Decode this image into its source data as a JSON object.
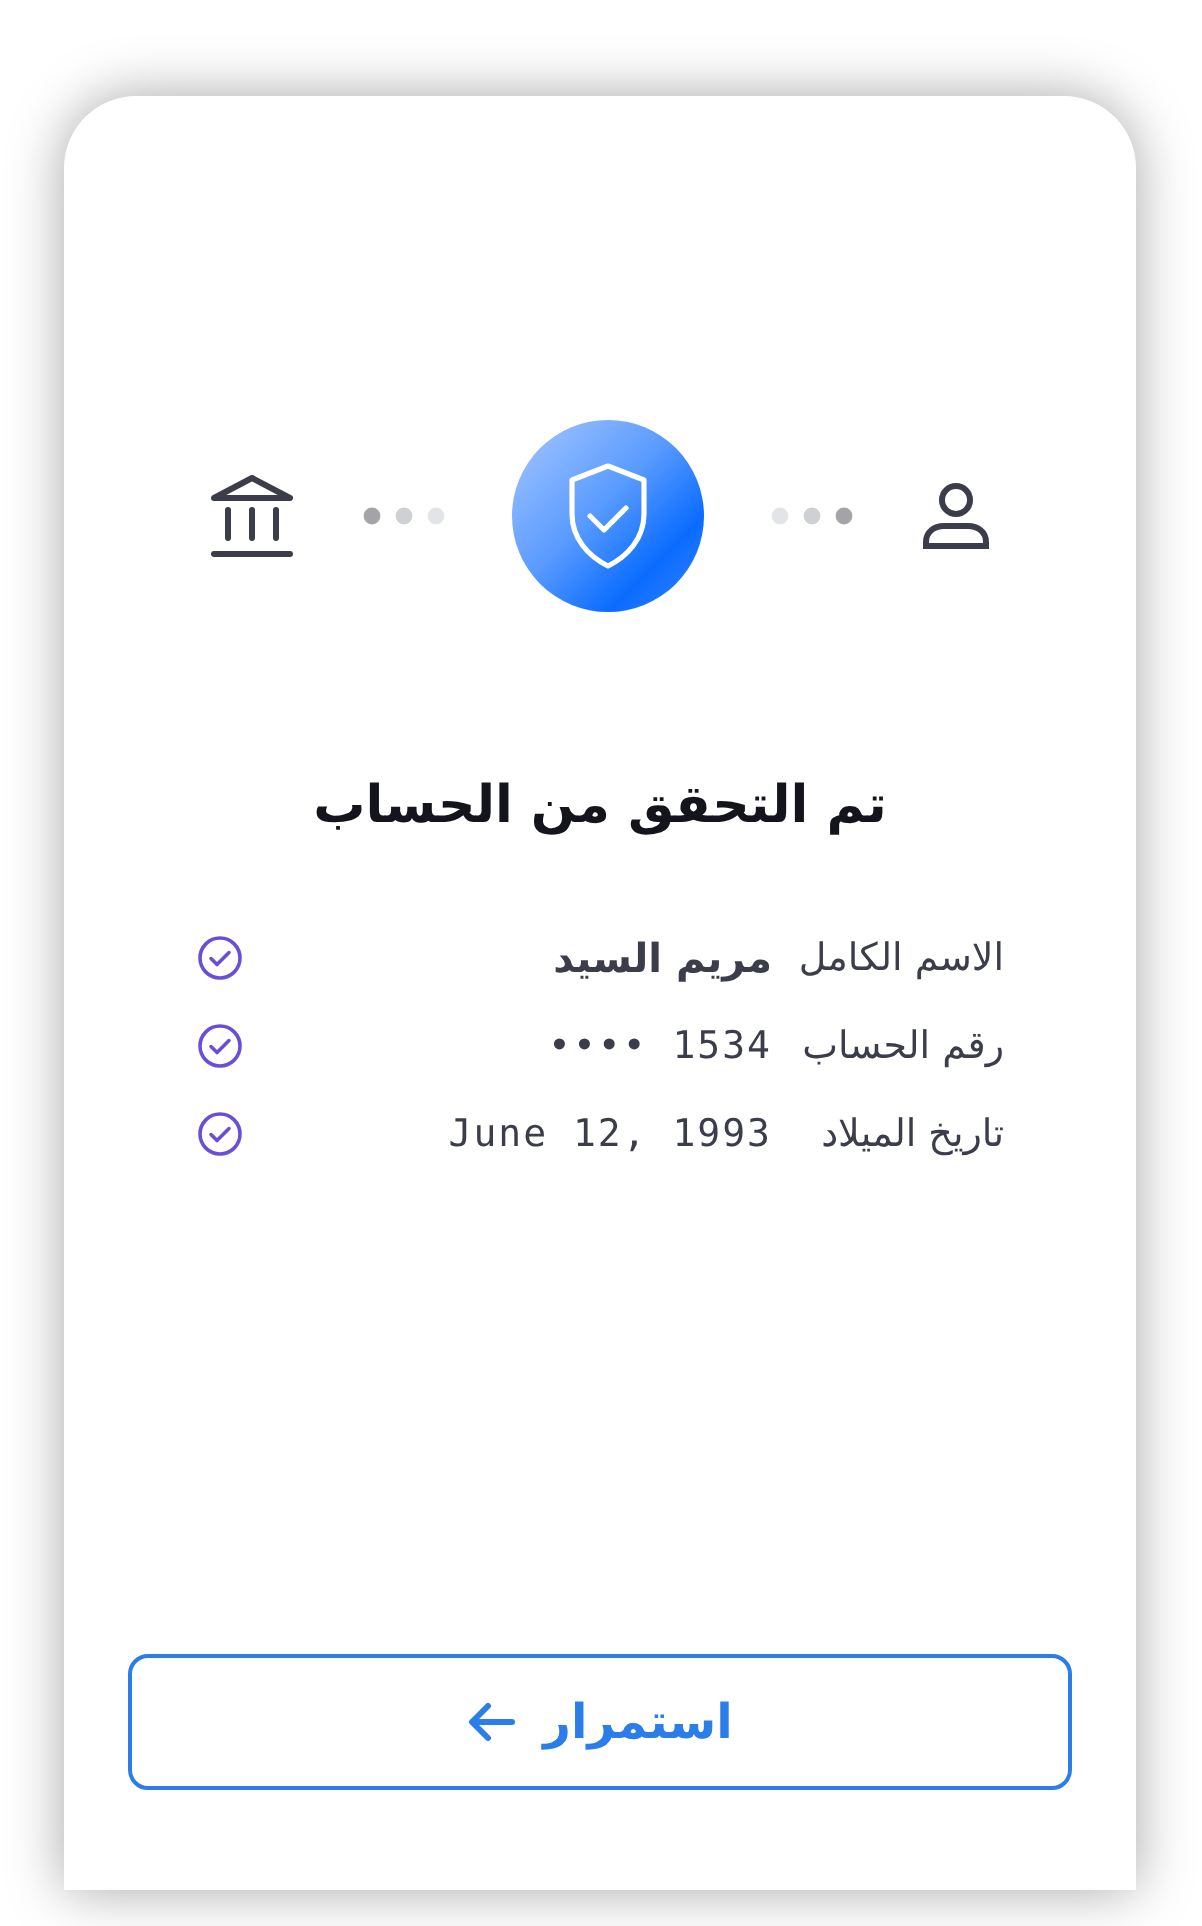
{
  "title": "تم التحقق من الحساب",
  "fields": [
    {
      "label": "الاسم الكامل",
      "value": "مريم السيد",
      "kind": "name",
      "verified": true
    },
    {
      "label": "رقم الحساب",
      "value": "•••• 1534",
      "kind": "mono",
      "verified": true
    },
    {
      "label": "تاريخ الميلاد",
      "value": "June 12, 1993",
      "kind": "mono",
      "verified": true
    }
  ],
  "button": {
    "label": "استمرار"
  }
}
